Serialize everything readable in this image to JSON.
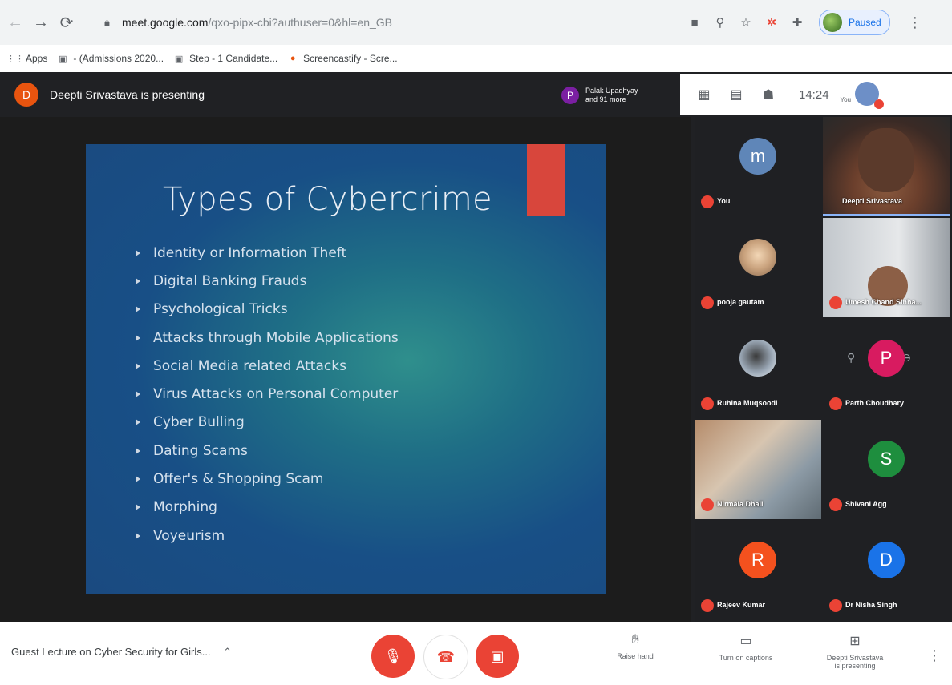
{
  "browser": {
    "url_domain": "meet.google.com",
    "url_path": "/qxo-pipx-cbi?authuser=0&hl=en_GB",
    "profile_status": "Paused",
    "bookmarks": [
      {
        "label": "Apps"
      },
      {
        "label": "- (Admissions 2020..."
      },
      {
        "label": "Step - 1 Candidate..."
      },
      {
        "label": "Screencastify - Scre..."
      }
    ]
  },
  "meet": {
    "presenter_initial": "D",
    "presenter_text": "Deepti Srivastava is presenting",
    "participants_chip": {
      "initial": "P",
      "line1": "Palak Upadhyay",
      "line2": "and 91 more"
    },
    "time": "14:24",
    "you_label": "You"
  },
  "slide": {
    "title": "Types of Cybercrime",
    "bullets": [
      "Identity or Information Theft",
      "Digital Banking Frauds",
      "Psychological Tricks",
      "Attacks through Mobile Applications",
      "Social Media related Attacks",
      "Virus Attacks on Personal Computer",
      "Cyber Bulling",
      "Dating Scams",
      "Offer's & Shopping Scam",
      "Morphing",
      "Voyeurism"
    ]
  },
  "participants": [
    {
      "name": "You",
      "initial": "m",
      "color": "#5f86b8"
    },
    {
      "name": "Deepti Srivastava"
    },
    {
      "name": "pooja gautam"
    },
    {
      "name": "Umesh Chand Sinha..."
    },
    {
      "name": "Ruhina Muqsoodi"
    },
    {
      "name": "Parth Choudhary",
      "initial": "P",
      "color": "#d81b60"
    },
    {
      "name": "Nirmala Dhali"
    },
    {
      "name": "Shivani Agg",
      "initial": "S",
      "color": "#1e8e3e"
    },
    {
      "name": "Rajeev Kumar",
      "initial": "R",
      "color": "#f4511e"
    },
    {
      "name": "Dr Nisha Singh",
      "initial": "D",
      "color": "#1a73e8"
    }
  ],
  "bottom": {
    "meeting_title": "Guest Lecture on Cyber Security for Girls...",
    "raise_hand": "Raise hand",
    "captions": "Turn on captions",
    "presenting_line1": "Deepti Srivastava",
    "presenting_line2": "is presenting"
  }
}
